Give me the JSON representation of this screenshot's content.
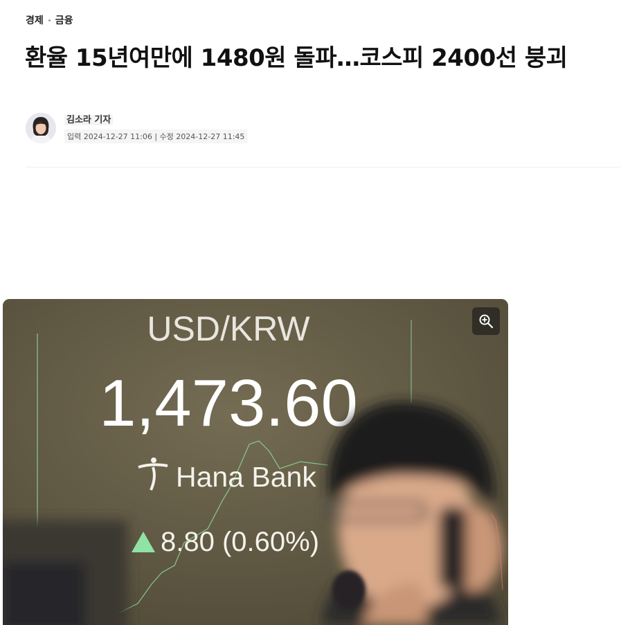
{
  "breadcrumb": {
    "section": "경제",
    "subsection": "금융"
  },
  "article": {
    "title": "환율 15년여만에 1480원 돌파…코스피 2400선 붕괴",
    "reporter": "김소라 기자",
    "dates": "입력 2024-12-27 11:06 | 수정 2024-12-27 11:45"
  },
  "photo": {
    "board_pair": "USD/KRW",
    "board_rate": "1,473.60",
    "board_bank": "Hana Bank",
    "board_change": "8.80 (0.60%)",
    "zoom_icon": "zoom-in-icon"
  },
  "colors": {
    "board_background": "#645e47",
    "up_arrow": "#8fe3a6",
    "board_text": "#f4f2ec"
  }
}
